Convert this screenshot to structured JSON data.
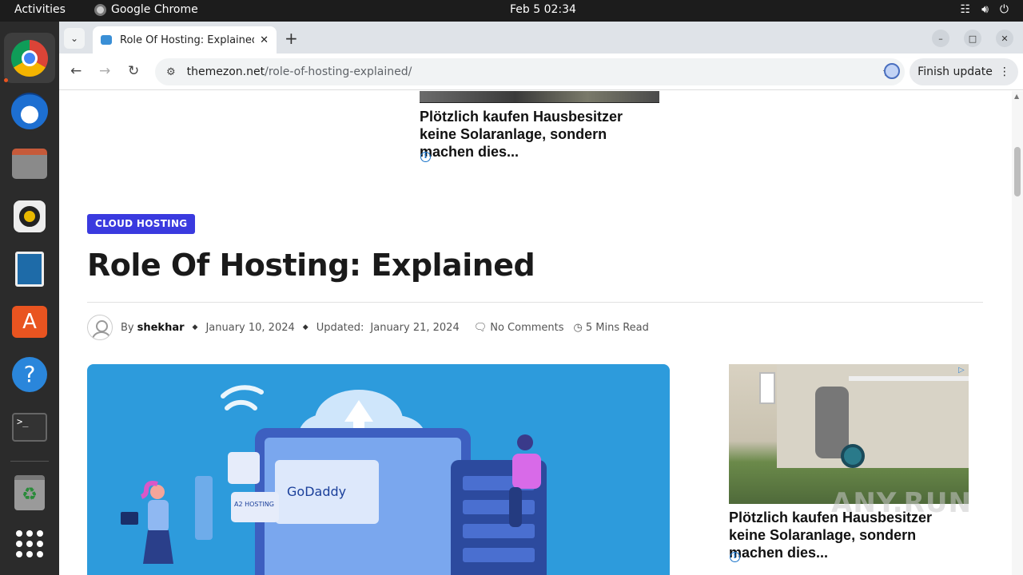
{
  "system": {
    "activities": "Activities",
    "app_name": "Google Chrome",
    "clock": "Feb 5  02:34"
  },
  "dock": {
    "items": [
      "Google Chrome",
      "Thunderbird Mail",
      "Files",
      "Rhythmbox",
      "LibreOffice Impress",
      "Ubuntu Software",
      "Help",
      "Terminal",
      "Trash",
      "Show Applications"
    ]
  },
  "browser": {
    "tab_title": "Role Of Hosting: Explained",
    "url_domain": "themezon.net",
    "url_path": "/role-of-hosting-explained/",
    "finish_update": "Finish update"
  },
  "page": {
    "top_ad": {
      "text": "Plötzlich kaufen Hausbesitzer keine Solaranlage, sondern machen dies..."
    },
    "category": "CLOUD HOSTING",
    "title": "Role Of Hosting: Explained",
    "meta": {
      "by": "By",
      "author": "shekhar",
      "published": "January 10, 2024",
      "updated_label": "Updated:",
      "updated": "January 21, 2024",
      "comments": "No Comments",
      "read_time": "5 Mins Read"
    },
    "hero_logos": {
      "godaddy": "GoDaddy",
      "a2": "A2 HOSTING"
    },
    "side_ad": {
      "text": "Plötzlich kaufen Hausbesitzer keine Solaranlage, sondern machen dies..."
    },
    "watermark": "ANY.RUN"
  },
  "colors": {
    "category_bg": "#3a3adf",
    "hero_bg": "#2d9bdc"
  }
}
